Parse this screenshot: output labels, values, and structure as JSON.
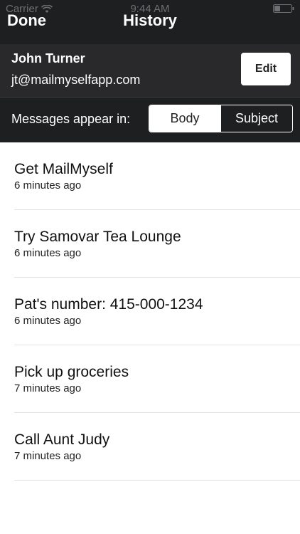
{
  "status_bar": {
    "carrier": "Carrier",
    "time": "9:44 AM"
  },
  "nav": {
    "done_label": "Done",
    "title": "History"
  },
  "account": {
    "name": "John Turner",
    "email": "jt@mailmyselfapp.com",
    "edit_label": "Edit"
  },
  "messages_setting": {
    "label": "Messages appear in:",
    "options": [
      "Body",
      "Subject"
    ],
    "selected": "Body"
  },
  "history": [
    {
      "title": "Get MailMyself",
      "time": "6 minutes ago"
    },
    {
      "title": "Try Samovar Tea Lounge",
      "time": "6 minutes ago"
    },
    {
      "title": "Pat's number: 415-000-1234",
      "time": "6 minutes ago"
    },
    {
      "title": "Pick up groceries",
      "time": "7 minutes ago"
    },
    {
      "title": "Call Aunt Judy",
      "time": "7 minutes ago"
    }
  ],
  "colors": {
    "header_bg": "#1e1f21",
    "account_bg": "#29292c",
    "separator": "#e3e3e6"
  },
  "icons": {
    "signal": "wifi-icon",
    "battery": "battery-icon"
  }
}
